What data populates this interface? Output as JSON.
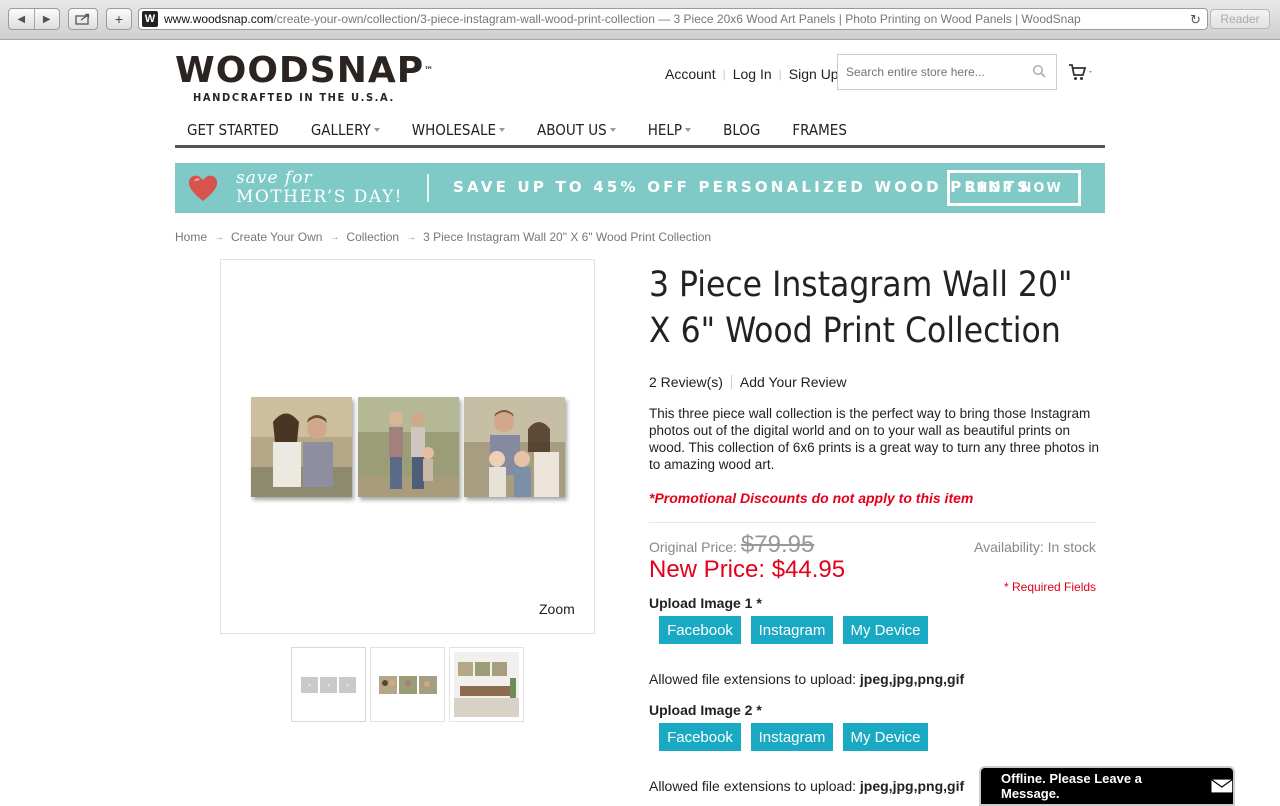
{
  "browser": {
    "url_host": "www.woodsnap.com",
    "url_rest": "/create-your-own/collection/3-piece-instagram-wall-wood-print-collection — 3 Piece 20x6 Wood Art Panels | Photo Printing on Wood Panels | WoodSnap",
    "favicon_letter": "W",
    "reader_label": "Reader"
  },
  "header": {
    "logo_text": "WOODSNAP",
    "logo_tm": "™",
    "logo_tagline": "HANDCRAFTED IN THE U.S.A.",
    "links": [
      "Account",
      "Log In",
      "Sign Up"
    ],
    "search_placeholder": "Search entire store here..."
  },
  "nav": {
    "items": [
      {
        "label": "GET STARTED",
        "dropdown": false
      },
      {
        "label": "GALLERY",
        "dropdown": true
      },
      {
        "label": "WHOLESALE",
        "dropdown": true
      },
      {
        "label": "ABOUT US",
        "dropdown": true
      },
      {
        "label": "HELP",
        "dropdown": true
      },
      {
        "label": "BLOG",
        "dropdown": false
      },
      {
        "label": "FRAMES",
        "dropdown": false
      }
    ]
  },
  "banner": {
    "save_for": "save for",
    "mothers_day": "MOTHER’S DAY!",
    "promo": "SAVE UP TO 45% OFF PERSONALIZED WOOD PRINTS",
    "cta": "SHOP NOW",
    "bg_color": "#7fcac6"
  },
  "breadcrumb": [
    "Home",
    "Create Your Own",
    "Collection",
    "3 Piece Instagram Wall 20\" X 6\" Wood Print Collection"
  ],
  "product": {
    "title": "3 Piece Instagram Wall 20\" X 6\" Wood Print Collection",
    "reviews": "2 Review(s)",
    "add_review": "Add Your Review",
    "description": "This three piece wall collection is the perfect way to bring those Instagram photos out of the digital world and on to your wall as beautiful prints on wood. This collection of 6x6 prints is a great way to turn any three photos in to amazing wood art.",
    "promo_note": "*Promotional Discounts do not apply to this item",
    "original_price_label": "Original Price:",
    "original_price": "$79.95",
    "new_price": "New Price: $44.95",
    "availability": "Availability: In stock",
    "required_fields": "* Required Fields",
    "zoom_label": "Zoom",
    "uploads": [
      {
        "label": "Upload Image 1 *",
        "buttons": [
          "Facebook",
          "Instagram",
          "My Device"
        ],
        "allowed_prefix": "Allowed file extensions to upload:",
        "allowed_ext": "jpeg,jpg,png,gif"
      },
      {
        "label": "Upload Image 2 *",
        "buttons": [
          "Facebook",
          "Instagram",
          "My Device"
        ],
        "allowed_prefix": "Allowed file extensions to upload:",
        "allowed_ext": "jpeg,jpg,png,gif"
      }
    ]
  },
  "chat": {
    "label": "Offline. Please Leave a Message."
  },
  "colors": {
    "accent": "#1aa9c2",
    "sale_red": "#e3001b"
  }
}
